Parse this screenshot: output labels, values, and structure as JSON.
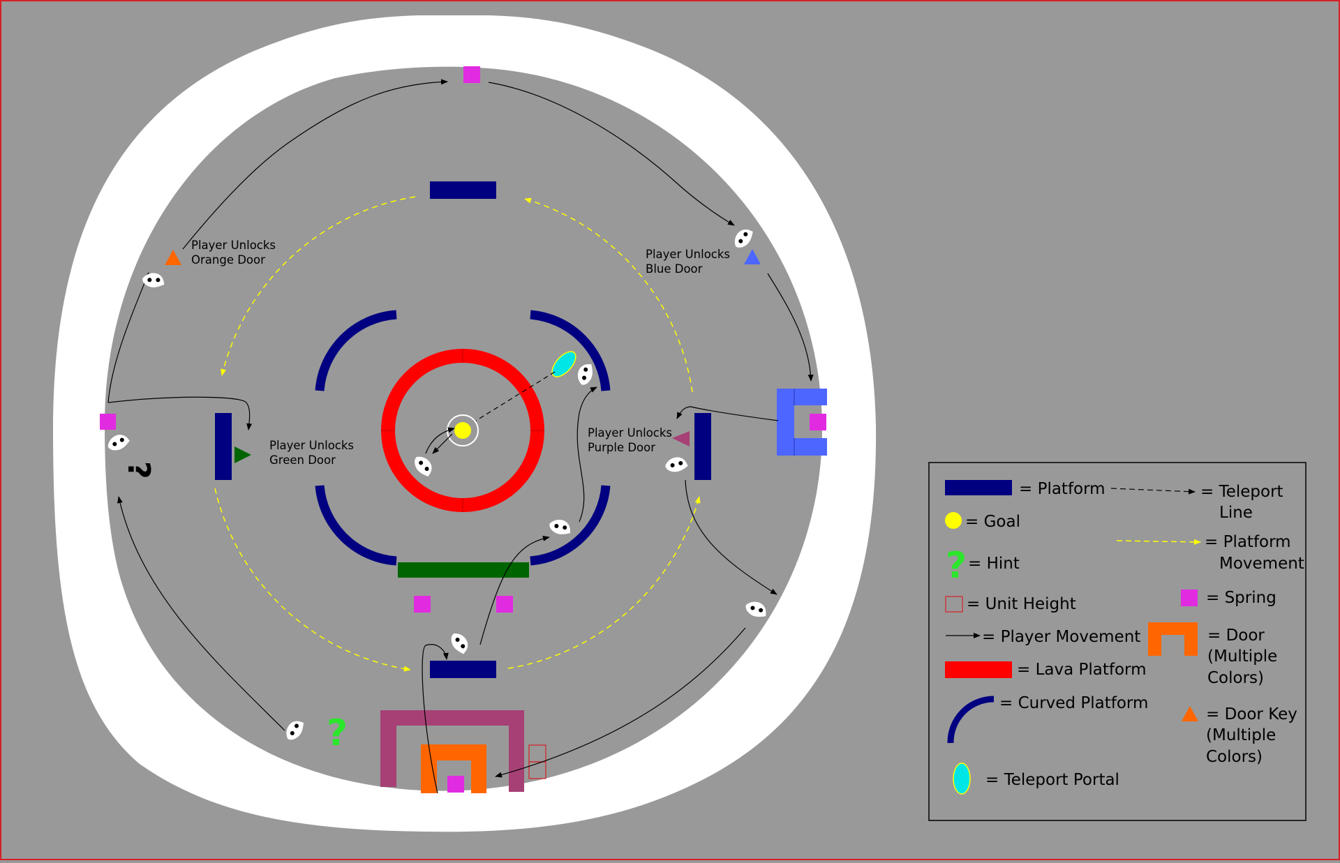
{
  "colors": {
    "background": "#999999",
    "border": "#d61f26",
    "track": "#ffffff",
    "platform": "#000080",
    "lava": "#ff0000",
    "green_door": "#006400",
    "purple_door": "#a64075",
    "orange": "#ff6600",
    "blue_door": "#4d66ff",
    "spring": "#e12be1",
    "goal": "#ffff00",
    "hint": "#2ce62c",
    "portal": "#00e6e6",
    "platform_movement": "#ffff00",
    "line": "#000000"
  },
  "annotations": {
    "orange_door": [
      "Player Unlocks",
      "Orange Door"
    ],
    "blue_door": [
      "Player Unlocks",
      "Blue Door"
    ],
    "green_door": [
      "Player Unlocks",
      "Green Door"
    ],
    "purple_door": [
      "Player Unlocks",
      "Purple Door"
    ]
  },
  "hint_glyph": "?",
  "legend": {
    "platform": "= Platform",
    "goal": "= Goal",
    "hint": "= Hint",
    "unit_height": "= Unit Height",
    "player_movement": "= Player Movement",
    "lava_platform": "= Lava Platform",
    "curved_platform": "= Curved Platform",
    "teleport_portal": "= Teleport Portal",
    "teleport_line": [
      "= Teleport",
      "Line"
    ],
    "platform_movement": [
      "= Platform",
      "Movement"
    ],
    "spring": "= Spring",
    "door": [
      "= Door",
      "(Multiple",
      "Colors)"
    ],
    "door_key": [
      "= Door Key",
      "(Multiple",
      "Colors)"
    ]
  }
}
